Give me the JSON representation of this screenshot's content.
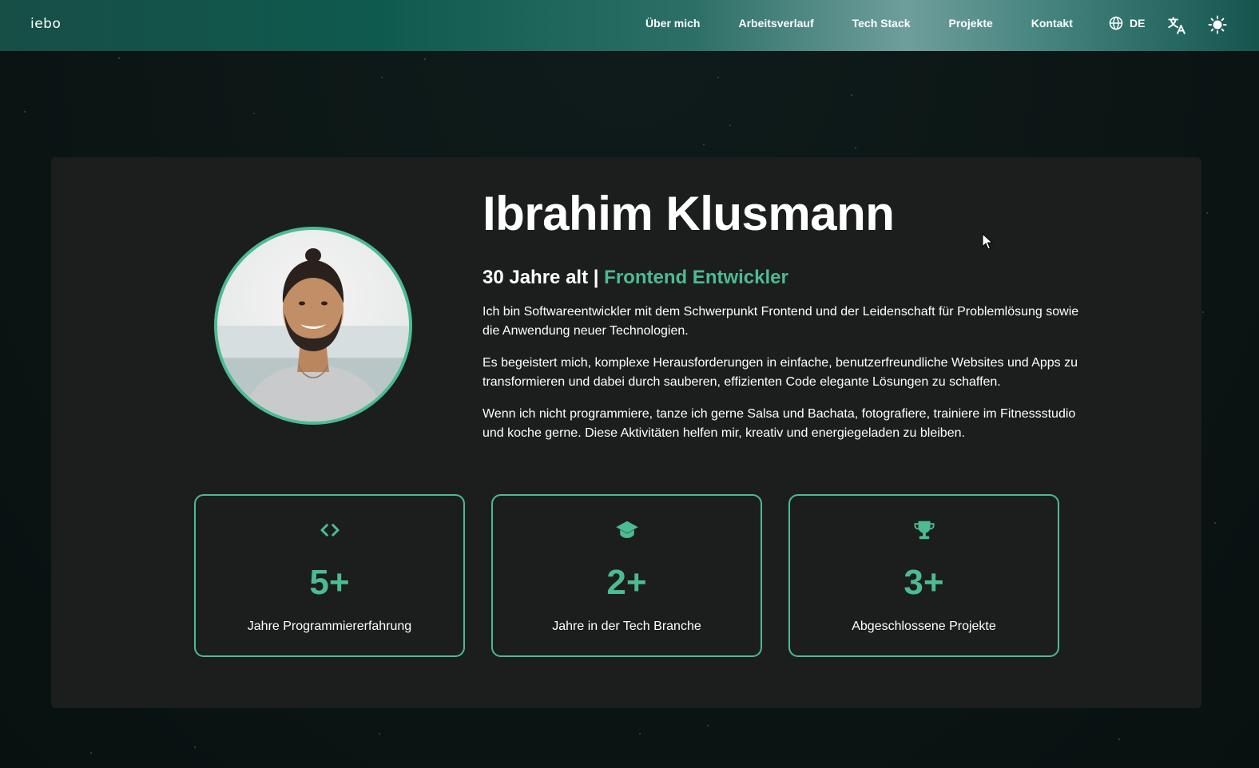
{
  "nav": {
    "logo": "iebo",
    "links": [
      "Über mich",
      "Arbeitsverlauf",
      "Tech Stack",
      "Projekte",
      "Kontakt"
    ],
    "language": "DE",
    "icons": {
      "language": "globe-icon",
      "translate": "translate-icon",
      "theme": "sun-icon"
    }
  },
  "about": {
    "name": "Ibrahim Klusmann",
    "age": "30 Jahre alt",
    "separator": "|",
    "role": "Frontend Entwickler",
    "paragraphs": [
      "Ich bin Softwareentwickler mit dem Schwerpunkt Frontend und der Leidenschaft für Problemlösung sowie die Anwendung neuer Technologien.",
      "Es begeistert mich, komplexe Herausforderungen in einfache, benutzerfreundliche Websites und Apps zu transformieren und dabei durch sauberen, effizienten Code elegante Lösungen zu schaffen.",
      "Wenn ich nicht programmiere, tanze ich gerne Salsa und Bachata, fotografiere, trainiere im Fitnessstudio und koche gerne. Diese Aktivitäten helfen mir, kreativ und energiegeladen zu bleiben."
    ]
  },
  "stats": [
    {
      "icon": "code-icon",
      "value": "5+",
      "label": "Jahre Programmiererfahrung"
    },
    {
      "icon": "graduation-cap-icon",
      "value": "2+",
      "label": "Jahre in der Tech Branche"
    },
    {
      "icon": "trophy-icon",
      "value": "3+",
      "label": "Abgeschlossene Projekte"
    }
  ],
  "colors": {
    "accent": "#4dbb92",
    "card": "#1c1e1e",
    "background": "#0b1514"
  }
}
